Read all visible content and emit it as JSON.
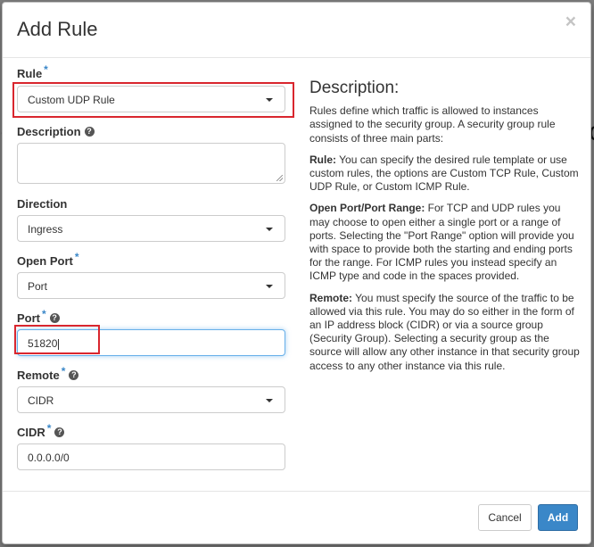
{
  "background": {
    "fragment_left": "(",
    "fragment_right": "o"
  },
  "modal": {
    "title": "Add Rule",
    "close_symbol": "×"
  },
  "form": {
    "rule": {
      "label": "Rule",
      "required": "*",
      "value": "Custom UDP Rule"
    },
    "description": {
      "label": "Description",
      "value": ""
    },
    "direction": {
      "label": "Direction",
      "value": "Ingress"
    },
    "open_port": {
      "label": "Open Port",
      "required": "*",
      "value": "Port"
    },
    "port": {
      "label": "Port",
      "required": "*",
      "value": "51820"
    },
    "remote": {
      "label": "Remote",
      "required": "*",
      "value": "CIDR"
    },
    "cidr": {
      "label": "CIDR",
      "required": "*",
      "value": "0.0.0.0/0"
    },
    "help_symbol": "?"
  },
  "help_panel": {
    "heading": "Description:",
    "intro": "Rules define which traffic is allowed to instances assigned to the security group. A security group rule consists of three main parts:",
    "rule_term": "Rule:",
    "rule_text": " You can specify the desired rule template or use custom rules, the options are Custom TCP Rule, Custom UDP Rule, or Custom ICMP Rule.",
    "port_term": "Open Port/Port Range:",
    "port_text": " For TCP and UDP rules you may choose to open either a single port or a range of ports. Selecting the \"Port Range\" option will provide you with space to provide both the starting and ending ports for the range. For ICMP rules you instead specify an ICMP type and code in the spaces provided.",
    "remote_term": "Remote:",
    "remote_text": " You must specify the source of the traffic to be allowed via this rule. You may do so either in the form of an IP address block (CIDR) or via a source group (Security Group). Selecting a security group as the source will allow any other instance in that security group access to any other instance via this rule."
  },
  "footer": {
    "cancel_label": "Cancel",
    "add_label": "Add"
  },
  "colors": {
    "accent": "#3a87c8",
    "highlight": "#d9262e"
  }
}
